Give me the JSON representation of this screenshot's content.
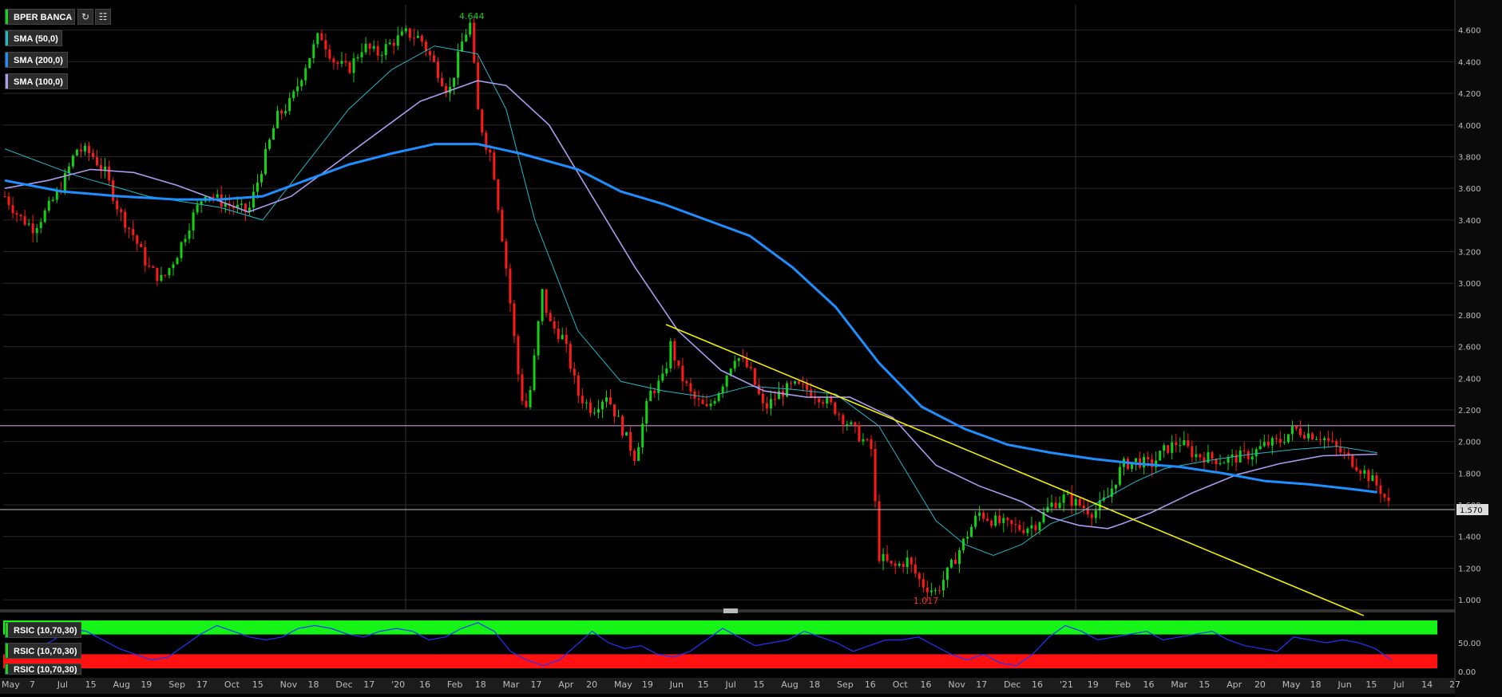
{
  "symbol": "BPER BANCA",
  "indicators": [
    {
      "label": "SMA (50,0)",
      "color": "#22b8c8"
    },
    {
      "label": "SMA (200,0)",
      "color": "#1e8fff"
    },
    {
      "label": "SMA (100,0)",
      "color": "#a99cf0"
    }
  ],
  "rsi": [
    {
      "label": "RSIC (10,70,30)"
    },
    {
      "label": "RSIC (10,70,30)"
    },
    {
      "label": "RSIC (10,70,30)"
    }
  ],
  "icons": {
    "refresh": "refresh-icon",
    "settings": "chart-settings-icon"
  },
  "chart_data": {
    "type": "candlestick",
    "price_axis": {
      "ticks": [
        "4.600",
        "4.400",
        "4.200",
        "4.000",
        "3.800",
        "3.600",
        "3.400",
        "3.200",
        "3.000",
        "2.800",
        "2.600",
        "2.400",
        "2.200",
        "2.000",
        "1.800",
        "1.600",
        "1.400",
        "1.200",
        "1.000"
      ],
      "ylim": [
        0.94,
        4.76
      ]
    },
    "rsi_axis": {
      "ticks": [
        "50.00",
        "0.00"
      ]
    },
    "x_ticks": [
      "May",
      "7",
      "Jul",
      "15",
      "Aug",
      "19",
      "Sep",
      "17",
      "Oct",
      "15",
      "Nov",
      "18",
      "Dec",
      "17",
      "'20",
      "16",
      "Feb",
      "18",
      "Mar",
      "17",
      "Apr",
      "20",
      "May",
      "19",
      "Jun",
      "15",
      "Jul",
      "15",
      "Aug",
      "18",
      "Sep",
      "16",
      "Oct",
      "16",
      "Nov",
      "17",
      "Dec",
      "16",
      "'21",
      "19",
      "Feb",
      "16",
      "Mar",
      "15",
      "Apr",
      "20",
      "May",
      "18",
      "Jun",
      "15",
      "Jul",
      "14",
      "27"
    ],
    "last_price": "1.570",
    "max_label": "4.644",
    "min_label": "1.017",
    "horizontal_line": 2.1,
    "trendline": {
      "from": [
        0.4615,
        2.74
      ],
      "to": [
        0.9486,
        0.9
      ]
    },
    "close_series": [
      [
        0.0,
        3.55
      ],
      [
        0.01,
        3.42
      ],
      [
        0.02,
        3.35
      ],
      [
        0.03,
        3.47
      ],
      [
        0.04,
        3.62
      ],
      [
        0.05,
        3.85
      ],
      [
        0.06,
        3.82
      ],
      [
        0.07,
        3.7
      ],
      [
        0.08,
        3.45
      ],
      [
        0.09,
        3.3
      ],
      [
        0.1,
        3.1
      ],
      [
        0.11,
        3.02
      ],
      [
        0.12,
        3.18
      ],
      [
        0.13,
        3.4
      ],
      [
        0.14,
        3.58
      ],
      [
        0.15,
        3.52
      ],
      [
        0.16,
        3.48
      ],
      [
        0.17,
        3.45
      ],
      [
        0.18,
        3.75
      ],
      [
        0.19,
        4.05
      ],
      [
        0.2,
        4.15
      ],
      [
        0.21,
        4.38
      ],
      [
        0.22,
        4.58
      ],
      [
        0.23,
        4.4
      ],
      [
        0.24,
        4.35
      ],
      [
        0.25,
        4.5
      ],
      [
        0.26,
        4.45
      ],
      [
        0.27,
        4.52
      ],
      [
        0.28,
        4.58
      ],
      [
        0.29,
        4.55
      ],
      [
        0.3,
        4.38
      ],
      [
        0.31,
        4.2
      ],
      [
        0.32,
        4.55
      ],
      [
        0.325,
        4.64
      ],
      [
        0.33,
        4.1
      ],
      [
        0.335,
        3.9
      ],
      [
        0.34,
        3.8
      ],
      [
        0.345,
        3.45
      ],
      [
        0.35,
        3.1
      ],
      [
        0.355,
        2.7
      ],
      [
        0.36,
        2.3
      ],
      [
        0.365,
        2.2
      ],
      [
        0.37,
        2.55
      ],
      [
        0.375,
        2.95
      ],
      [
        0.38,
        2.75
      ],
      [
        0.39,
        2.65
      ],
      [
        0.4,
        2.3
      ],
      [
        0.41,
        2.2
      ],
      [
        0.42,
        2.3
      ],
      [
        0.43,
        2.1
      ],
      [
        0.44,
        1.9
      ],
      [
        0.45,
        2.3
      ],
      [
        0.46,
        2.4
      ],
      [
        0.465,
        2.62
      ],
      [
        0.47,
        2.45
      ],
      [
        0.48,
        2.28
      ],
      [
        0.49,
        2.2
      ],
      [
        0.5,
        2.35
      ],
      [
        0.51,
        2.55
      ],
      [
        0.52,
        2.45
      ],
      [
        0.53,
        2.2
      ],
      [
        0.54,
        2.3
      ],
      [
        0.55,
        2.35
      ],
      [
        0.56,
        2.33
      ],
      [
        0.57,
        2.28
      ],
      [
        0.58,
        2.2
      ],
      [
        0.59,
        2.1
      ],
      [
        0.6,
        2.0
      ],
      [
        0.605,
        1.95
      ],
      [
        0.61,
        1.28
      ],
      [
        0.62,
        1.2
      ],
      [
        0.63,
        1.25
      ],
      [
        0.64,
        1.1
      ],
      [
        0.65,
        1.05
      ],
      [
        0.66,
        1.2
      ],
      [
        0.67,
        1.38
      ],
      [
        0.68,
        1.55
      ],
      [
        0.69,
        1.5
      ],
      [
        0.7,
        1.47
      ],
      [
        0.71,
        1.45
      ],
      [
        0.72,
        1.48
      ],
      [
        0.73,
        1.6
      ],
      [
        0.74,
        1.65
      ],
      [
        0.75,
        1.6
      ],
      [
        0.76,
        1.55
      ],
      [
        0.77,
        1.65
      ],
      [
        0.78,
        1.85
      ],
      [
        0.79,
        1.88
      ],
      [
        0.8,
        1.85
      ],
      [
        0.81,
        1.95
      ],
      [
        0.82,
        2.0
      ],
      [
        0.83,
        1.92
      ],
      [
        0.84,
        1.9
      ],
      [
        0.85,
        1.88
      ],
      [
        0.86,
        1.9
      ],
      [
        0.87,
        1.92
      ],
      [
        0.88,
        1.98
      ],
      [
        0.89,
        2.0
      ],
      [
        0.9,
        2.08
      ],
      [
        0.91,
        2.05
      ],
      [
        0.92,
        2.03
      ],
      [
        0.93,
        1.95
      ],
      [
        0.94,
        1.88
      ],
      [
        0.95,
        1.8
      ],
      [
        0.96,
        1.7
      ],
      [
        0.968,
        1.57
      ]
    ],
    "series": [
      {
        "label_ref": "SMA (50,0)",
        "points": [
          [
            0,
            3.85
          ],
          [
            0.05,
            3.68
          ],
          [
            0.1,
            3.55
          ],
          [
            0.15,
            3.48
          ],
          [
            0.18,
            3.4
          ],
          [
            0.21,
            3.75
          ],
          [
            0.24,
            4.1
          ],
          [
            0.27,
            4.35
          ],
          [
            0.3,
            4.5
          ],
          [
            0.33,
            4.45
          ],
          [
            0.35,
            4.1
          ],
          [
            0.37,
            3.4
          ],
          [
            0.4,
            2.7
          ],
          [
            0.43,
            2.38
          ],
          [
            0.46,
            2.32
          ],
          [
            0.49,
            2.28
          ],
          [
            0.52,
            2.35
          ],
          [
            0.55,
            2.33
          ],
          [
            0.58,
            2.3
          ],
          [
            0.61,
            2.1
          ],
          [
            0.63,
            1.8
          ],
          [
            0.65,
            1.5
          ],
          [
            0.67,
            1.35
          ],
          [
            0.69,
            1.28
          ],
          [
            0.71,
            1.35
          ],
          [
            0.73,
            1.48
          ],
          [
            0.75,
            1.55
          ],
          [
            0.77,
            1.65
          ],
          [
            0.79,
            1.75
          ],
          [
            0.81,
            1.83
          ],
          [
            0.84,
            1.88
          ],
          [
            0.87,
            1.92
          ],
          [
            0.9,
            1.95
          ],
          [
            0.93,
            1.97
          ],
          [
            0.958,
            1.93
          ]
        ]
      },
      {
        "label_ref": "SMA (100,0)",
        "points": [
          [
            0,
            3.6
          ],
          [
            0.03,
            3.65
          ],
          [
            0.06,
            3.72
          ],
          [
            0.09,
            3.7
          ],
          [
            0.12,
            3.62
          ],
          [
            0.15,
            3.52
          ],
          [
            0.17,
            3.45
          ],
          [
            0.2,
            3.55
          ],
          [
            0.23,
            3.75
          ],
          [
            0.26,
            3.95
          ],
          [
            0.29,
            4.15
          ],
          [
            0.33,
            4.28
          ],
          [
            0.35,
            4.25
          ],
          [
            0.38,
            4.0
          ],
          [
            0.41,
            3.55
          ],
          [
            0.44,
            3.1
          ],
          [
            0.47,
            2.7
          ],
          [
            0.5,
            2.45
          ],
          [
            0.53,
            2.32
          ],
          [
            0.56,
            2.28
          ],
          [
            0.59,
            2.28
          ],
          [
            0.62,
            2.15
          ],
          [
            0.65,
            1.85
          ],
          [
            0.68,
            1.72
          ],
          [
            0.71,
            1.62
          ],
          [
            0.73,
            1.52
          ],
          [
            0.75,
            1.47
          ],
          [
            0.77,
            1.45
          ],
          [
            0.78,
            1.48
          ],
          [
            0.8,
            1.55
          ],
          [
            0.83,
            1.68
          ],
          [
            0.86,
            1.79
          ],
          [
            0.89,
            1.86
          ],
          [
            0.92,
            1.91
          ],
          [
            0.958,
            1.92
          ]
        ]
      },
      {
        "label_ref": "SMA (200,0)",
        "points": [
          [
            0,
            3.65
          ],
          [
            0.04,
            3.58
          ],
          [
            0.08,
            3.55
          ],
          [
            0.12,
            3.53
          ],
          [
            0.15,
            3.53
          ],
          [
            0.18,
            3.55
          ],
          [
            0.21,
            3.65
          ],
          [
            0.24,
            3.75
          ],
          [
            0.27,
            3.82
          ],
          [
            0.3,
            3.88
          ],
          [
            0.33,
            3.88
          ],
          [
            0.36,
            3.82
          ],
          [
            0.4,
            3.72
          ],
          [
            0.43,
            3.58
          ],
          [
            0.46,
            3.5
          ],
          [
            0.49,
            3.4
          ],
          [
            0.52,
            3.3
          ],
          [
            0.55,
            3.1
          ],
          [
            0.58,
            2.85
          ],
          [
            0.61,
            2.5
          ],
          [
            0.64,
            2.22
          ],
          [
            0.67,
            2.08
          ],
          [
            0.7,
            1.98
          ],
          [
            0.73,
            1.93
          ],
          [
            0.76,
            1.89
          ],
          [
            0.79,
            1.86
          ],
          [
            0.82,
            1.84
          ],
          [
            0.85,
            1.8
          ],
          [
            0.88,
            1.75
          ],
          [
            0.91,
            1.73
          ],
          [
            0.94,
            1.7
          ],
          [
            0.958,
            1.68
          ]
        ]
      }
    ],
    "rsi_values": [
      50,
      45,
      40,
      55,
      75,
      70,
      55,
      40,
      30,
      20,
      25,
      45,
      65,
      80,
      70,
      60,
      55,
      60,
      75,
      80,
      75,
      65,
      60,
      70,
      75,
      70,
      55,
      60,
      75,
      85,
      70,
      35,
      20,
      10,
      20,
      45,
      70,
      50,
      40,
      45,
      30,
      25,
      35,
      55,
      75,
      60,
      45,
      50,
      55,
      70,
      60,
      50,
      35,
      45,
      55,
      55,
      60,
      45,
      30,
      20,
      30,
      15,
      10,
      30,
      60,
      80,
      70,
      55,
      60,
      65,
      70,
      55,
      60,
      65,
      70,
      55,
      45,
      40,
      35,
      60,
      55,
      50,
      55,
      50,
      40,
      20
    ]
  }
}
